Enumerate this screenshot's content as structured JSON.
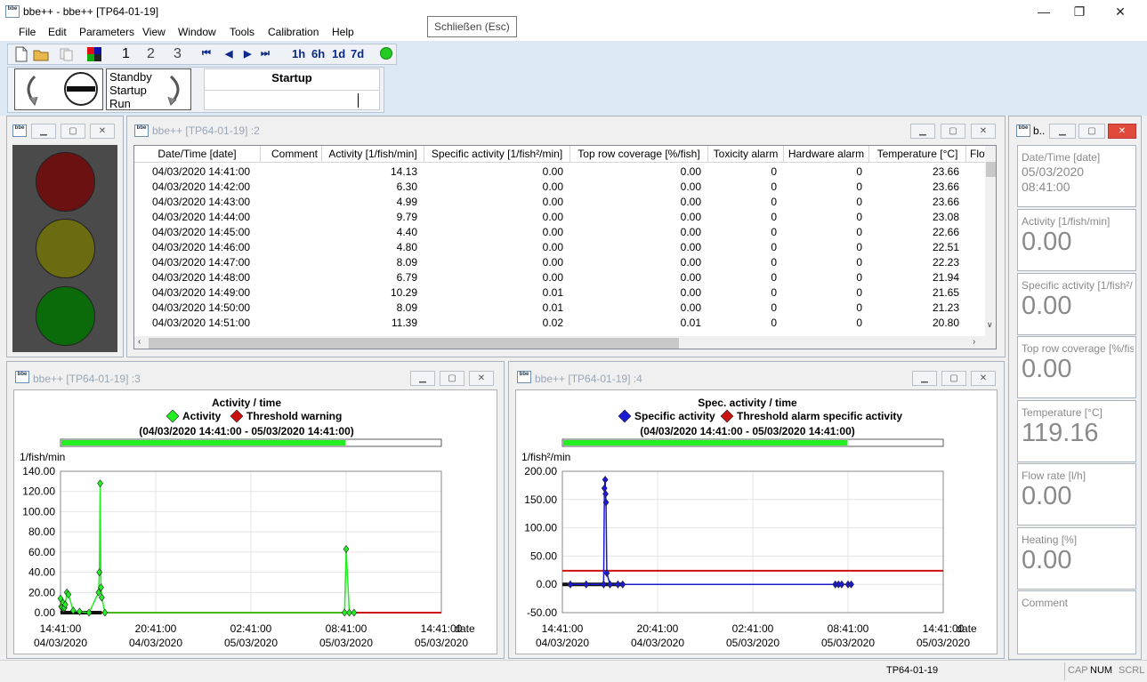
{
  "app": {
    "title": "bbe++ - bbe++ [TP64-01-19]",
    "tooltip": "Schließen (Esc)",
    "icon_text": "bbe"
  },
  "window_controls": {
    "minimize": "—",
    "maximize": "❐",
    "close": "✕"
  },
  "menu": [
    "File",
    "Edit",
    "Parameters",
    "View",
    "Window",
    "Tools",
    "Calibration",
    "Help"
  ],
  "toolbar": {
    "numbers": [
      "1",
      "2",
      "3"
    ],
    "nav": [
      "⏮",
      "◀",
      "▶",
      "⏭"
    ],
    "ranges": [
      "1h",
      "6h",
      "1d",
      "7d"
    ],
    "status_color": "#22cc22",
    "mode_lines": [
      "Standby",
      "Startup",
      "Run"
    ],
    "state_title": "Startup"
  },
  "traffic": {
    "caption_buttons": [
      "▁",
      "▢",
      "✕"
    ],
    "red": "#6b1111",
    "yellow": "#6b6b11",
    "green": "#0b6b0b"
  },
  "table_window": {
    "title": "bbe++ [TP64-01-19] :2",
    "headers": [
      "Date/Time [date]",
      "Comment",
      "Activity [1/fish/min]",
      "Specific activity [1/fish²/min]",
      "Top row coverage [%/fish]",
      "Toxicity alarm",
      "Hardware alarm",
      "Temperature [°C]",
      "Flow"
    ],
    "rows": [
      [
        "04/03/2020 14:41:00",
        "",
        "14.13",
        "0.00",
        "0.00",
        "0",
        "0",
        "23.66"
      ],
      [
        "04/03/2020 14:42:00",
        "",
        "6.30",
        "0.00",
        "0.00",
        "0",
        "0",
        "23.66"
      ],
      [
        "04/03/2020 14:43:00",
        "",
        "4.99",
        "0.00",
        "0.00",
        "0",
        "0",
        "23.66"
      ],
      [
        "04/03/2020 14:44:00",
        "",
        "9.79",
        "0.00",
        "0.00",
        "0",
        "0",
        "23.08"
      ],
      [
        "04/03/2020 14:45:00",
        "",
        "4.40",
        "0.00",
        "0.00",
        "0",
        "0",
        "22.66"
      ],
      [
        "04/03/2020 14:46:00",
        "",
        "4.80",
        "0.00",
        "0.00",
        "0",
        "0",
        "22.51"
      ],
      [
        "04/03/2020 14:47:00",
        "",
        "8.09",
        "0.00",
        "0.00",
        "0",
        "0",
        "22.23"
      ],
      [
        "04/03/2020 14:48:00",
        "",
        "6.79",
        "0.00",
        "0.00",
        "0",
        "0",
        "21.94"
      ],
      [
        "04/03/2020 14:49:00",
        "",
        "10.29",
        "0.01",
        "0.00",
        "0",
        "0",
        "21.65"
      ],
      [
        "04/03/2020 14:50:00",
        "",
        "8.09",
        "0.01",
        "0.00",
        "0",
        "0",
        "21.23"
      ],
      [
        "04/03/2020 14:51:00",
        "",
        "11.39",
        "0.02",
        "0.01",
        "0",
        "0",
        "20.80"
      ]
    ]
  },
  "chart1_window": {
    "title": "bbe++ [TP64-01-19] :3"
  },
  "chart2_window": {
    "title": "bbe++ [TP64-01-19] :4"
  },
  "chart_data": [
    {
      "type": "line",
      "title": "Activity / time",
      "legend": [
        "Activity",
        "Threshold warning"
      ],
      "range_text": "(04/03/2020 14:41:00 - 05/03/2020 14:41:00)",
      "progress": 0.75,
      "ylabel": "1/fish/min",
      "xlabel": "date",
      "ylim": [
        0,
        140
      ],
      "yticks": [
        "140.00",
        "120.00",
        "100.00",
        "80.00",
        "60.00",
        "40.00",
        "20.00",
        "0.00"
      ],
      "xticks": [
        [
          "14:41:00",
          "04/03/2020"
        ],
        [
          "20:41:00",
          "04/03/2020"
        ],
        [
          "02:41:00",
          "05/03/2020"
        ],
        [
          "08:41:00",
          "05/03/2020"
        ],
        [
          "14:41:00",
          "05/03/2020"
        ]
      ],
      "series": [
        {
          "name": "Activity",
          "color": "#22ee22",
          "x_hours": [
            0.0,
            0.05,
            0.1,
            0.15,
            0.2,
            0.25,
            0.3,
            0.4,
            0.5,
            0.8,
            1.2,
            1.8,
            2.4,
            2.45,
            2.5,
            2.55,
            2.6,
            2.8,
            17.9,
            18.0,
            18.2,
            18.5
          ],
          "values": [
            14,
            6,
            5,
            10,
            4,
            5,
            8,
            20,
            18,
            2,
            1,
            0,
            20,
            40,
            128,
            25,
            15,
            0,
            0,
            63,
            0,
            0
          ]
        },
        {
          "name": "Threshold warning",
          "color": "#cc1111",
          "values": [
            0,
            0
          ]
        }
      ]
    },
    {
      "type": "line",
      "title": "Spec. activity / time",
      "legend": [
        "Specific activity",
        "Threshold alarm specific activity"
      ],
      "range_text": "(04/03/2020 14:41:00 - 05/03/2020 14:41:00)",
      "progress": 0.75,
      "ylabel": "1/fish²/min",
      "xlabel": "date",
      "ylim": [
        -50,
        200
      ],
      "yticks": [
        "200.00",
        "150.00",
        "100.00",
        "50.00",
        "0.00",
        "-50.00"
      ],
      "xticks": [
        [
          "14:41:00",
          "04/03/2020"
        ],
        [
          "20:41:00",
          "04/03/2020"
        ],
        [
          "02:41:00",
          "05/03/2020"
        ],
        [
          "08:41:00",
          "05/03/2020"
        ],
        [
          "14:41:00",
          "05/03/2020"
        ]
      ],
      "series": [
        {
          "name": "Specific activity",
          "color": "#1a1ad6",
          "x_hours": [
            0.5,
            1.5,
            2.6,
            2.65,
            2.7,
            2.72,
            2.75,
            2.8,
            3.0,
            3.5,
            3.8,
            17.2,
            17.4,
            17.6,
            18.0,
            18.2
          ],
          "values": [
            0,
            0,
            0,
            170,
            185,
            160,
            145,
            20,
            0,
            0,
            0,
            0,
            0,
            0,
            0,
            0
          ]
        },
        {
          "name": "Threshold alarm specific activity",
          "color": "#cc1111",
          "values": [
            24,
            24
          ]
        }
      ]
    }
  ],
  "right_panel": {
    "title": "b..",
    "fields": [
      {
        "label": "Date/Time [date]",
        "value": "05/03/2020",
        "value2": "08:41:00"
      },
      {
        "label": "Activity [1/fish/min]",
        "value": "0.00"
      },
      {
        "label": "Specific activity [1/fish²/",
        "value": "0.00"
      },
      {
        "label": "Top row coverage [%/fis",
        "value": "0.00"
      },
      {
        "label": "Temperature [°C]",
        "value": "119.16"
      },
      {
        "label": "Flow rate [l/h]",
        "value": "0.00"
      },
      {
        "label": "Heating [%]",
        "value": "0.00"
      },
      {
        "label": "Comment",
        "value": ""
      }
    ]
  },
  "statusbar": {
    "device": "TP64-01-19",
    "cap": "CAP",
    "num": "NUM",
    "scrl": "SCRL"
  }
}
